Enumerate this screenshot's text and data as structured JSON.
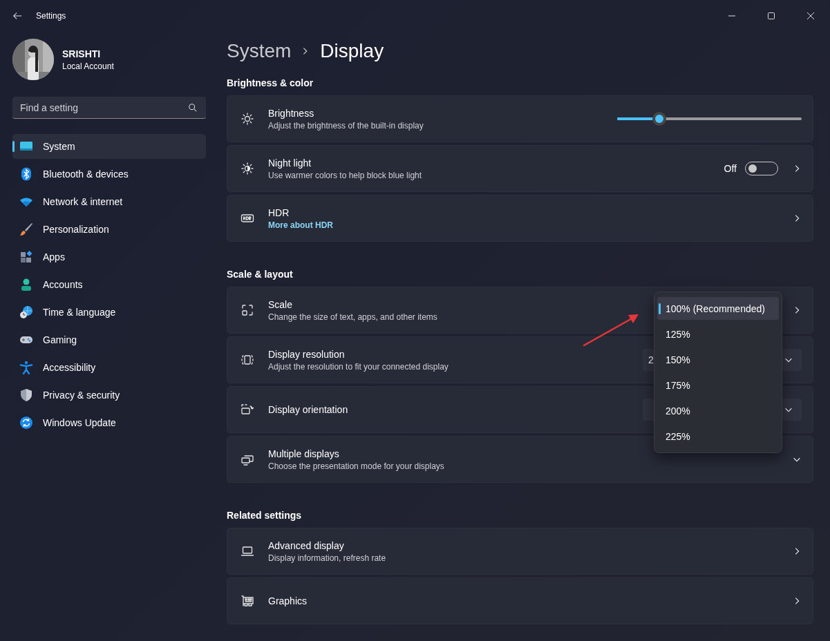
{
  "window": {
    "title": "Settings"
  },
  "account": {
    "name": "SRISHTI",
    "type": "Local Account"
  },
  "search": {
    "placeholder": "Find a setting"
  },
  "nav": [
    {
      "label": "System",
      "selected": true
    },
    {
      "label": "Bluetooth & devices",
      "selected": false
    },
    {
      "label": "Network & internet",
      "selected": false
    },
    {
      "label": "Personalization",
      "selected": false
    },
    {
      "label": "Apps",
      "selected": false
    },
    {
      "label": "Accounts",
      "selected": false
    },
    {
      "label": "Time & language",
      "selected": false
    },
    {
      "label": "Gaming",
      "selected": false
    },
    {
      "label": "Accessibility",
      "selected": false
    },
    {
      "label": "Privacy & security",
      "selected": false
    },
    {
      "label": "Windows Update",
      "selected": false
    }
  ],
  "breadcrumb": [
    "System",
    "Display"
  ],
  "sections": [
    {
      "title": "Brightness & color",
      "rows": [
        {
          "kind": "slider",
          "title": "Brightness",
          "subtitle": "Adjust the brightness of the built-in display",
          "level": 0.23
        },
        {
          "kind": "toggle",
          "title": "Night light",
          "subtitle": "Use warmer colors to help block blue light",
          "state_text": "Off",
          "on": false
        },
        {
          "kind": "link",
          "title": "HDR",
          "link": "More about HDR"
        }
      ]
    },
    {
      "title": "Scale & layout",
      "rows": [
        {
          "kind": "nav",
          "title": "Scale",
          "subtitle": "Change the size of text, apps, and other items"
        },
        {
          "kind": "dropdown",
          "title": "Display resolution",
          "subtitle": "Adjust the resolution to fit your connected display",
          "value": "2"
        },
        {
          "kind": "dropdown",
          "title": "Display orientation"
        },
        {
          "kind": "expander",
          "title": "Multiple displays",
          "subtitle": "Choose the presentation mode for your displays"
        }
      ]
    },
    {
      "title": "Related settings",
      "rows": [
        {
          "kind": "nav",
          "title": "Advanced display",
          "subtitle": "Display information, refresh rate"
        },
        {
          "kind": "nav",
          "title": "Graphics"
        }
      ]
    }
  ],
  "scale_menu": {
    "options": [
      {
        "label": "100% (Recommended)",
        "selected": true
      },
      {
        "label": "125%",
        "selected": false
      },
      {
        "label": "150%",
        "selected": false
      },
      {
        "label": "175%",
        "selected": false
      },
      {
        "label": "200%",
        "selected": false
      },
      {
        "label": "225%",
        "selected": false
      }
    ]
  }
}
